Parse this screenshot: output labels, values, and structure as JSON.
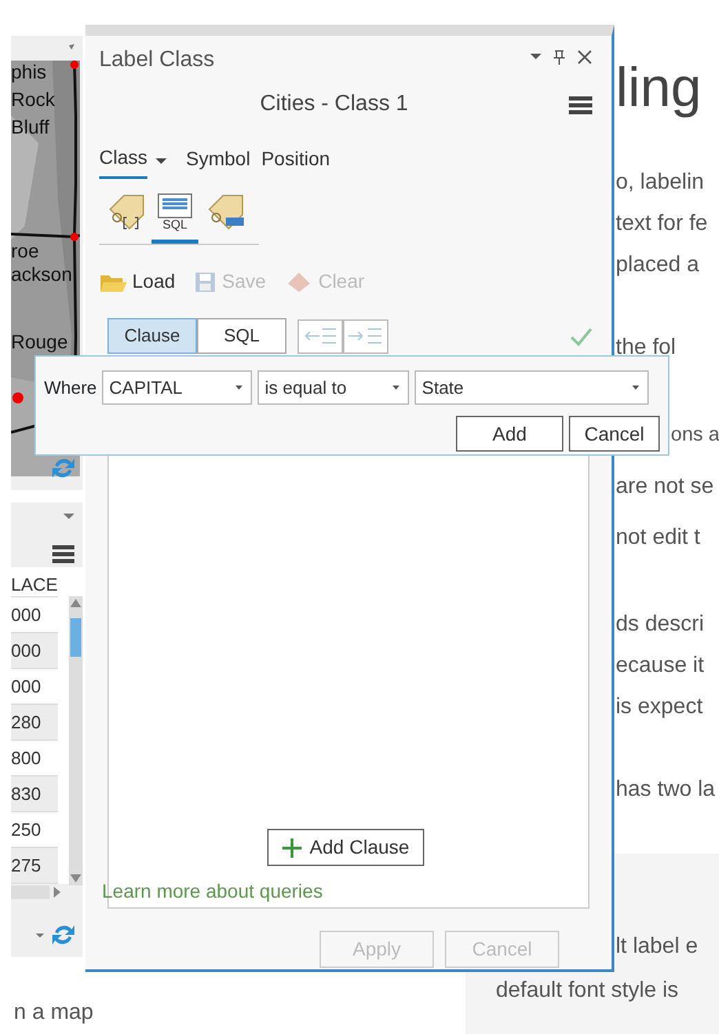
{
  "background_page": {
    "heading": "ling",
    "paragraphs": [
      [
        "o, labelin",
        "text for fe",
        "placed a"
      ],
      [
        "the fol"
      ],
      [
        "ons a",
        "are not se",
        "not edit t"
      ],
      [
        "ds descri",
        "ecause it",
        "is expect"
      ],
      [
        "has two la"
      ]
    ],
    "note_lines": [
      "lt label e",
      "default font style is"
    ],
    "caption": "n a map"
  },
  "map_pane": {
    "labels": [
      "phis",
      "Rock",
      "Bluff",
      "roe",
      "ackson",
      "Rouge"
    ]
  },
  "table_pane": {
    "column_1": "LACE",
    "rows": [
      "000",
      "000",
      "000",
      "280",
      "800",
      "830",
      "250",
      "275"
    ]
  },
  "label_class": {
    "title": "Label Class",
    "class_name": "Cities - Class 1",
    "tabs": [
      {
        "label": "Class",
        "selected": true
      },
      {
        "label": "Symbol",
        "selected": false
      },
      {
        "label": "Position",
        "selected": false
      }
    ],
    "icon_tabs": [
      {
        "kind": "label",
        "selected": false
      },
      {
        "kind": "sql",
        "label": "SQL",
        "selected": true
      },
      {
        "kind": "tag",
        "selected": false
      }
    ],
    "tools": [
      {
        "kind": "load",
        "label": "Load",
        "disabled": false
      },
      {
        "kind": "save",
        "label": "Save",
        "disabled": true
      },
      {
        "kind": "clear",
        "label": "Clear",
        "disabled": true
      }
    ],
    "modes": [
      {
        "label": "Clause",
        "selected": true
      },
      {
        "label": "SQL",
        "selected": false
      }
    ],
    "add_clause": "Add Clause",
    "link": "Learn more about queries",
    "buttons": [
      {
        "label": "Apply",
        "disabled": true
      },
      {
        "label": "Cancel",
        "disabled": true
      }
    ]
  },
  "clause_popup": {
    "where": "Where",
    "field": "CAPITAL",
    "operator": "is equal to",
    "value": "State",
    "buttons": [
      "Add",
      "Cancel"
    ]
  }
}
